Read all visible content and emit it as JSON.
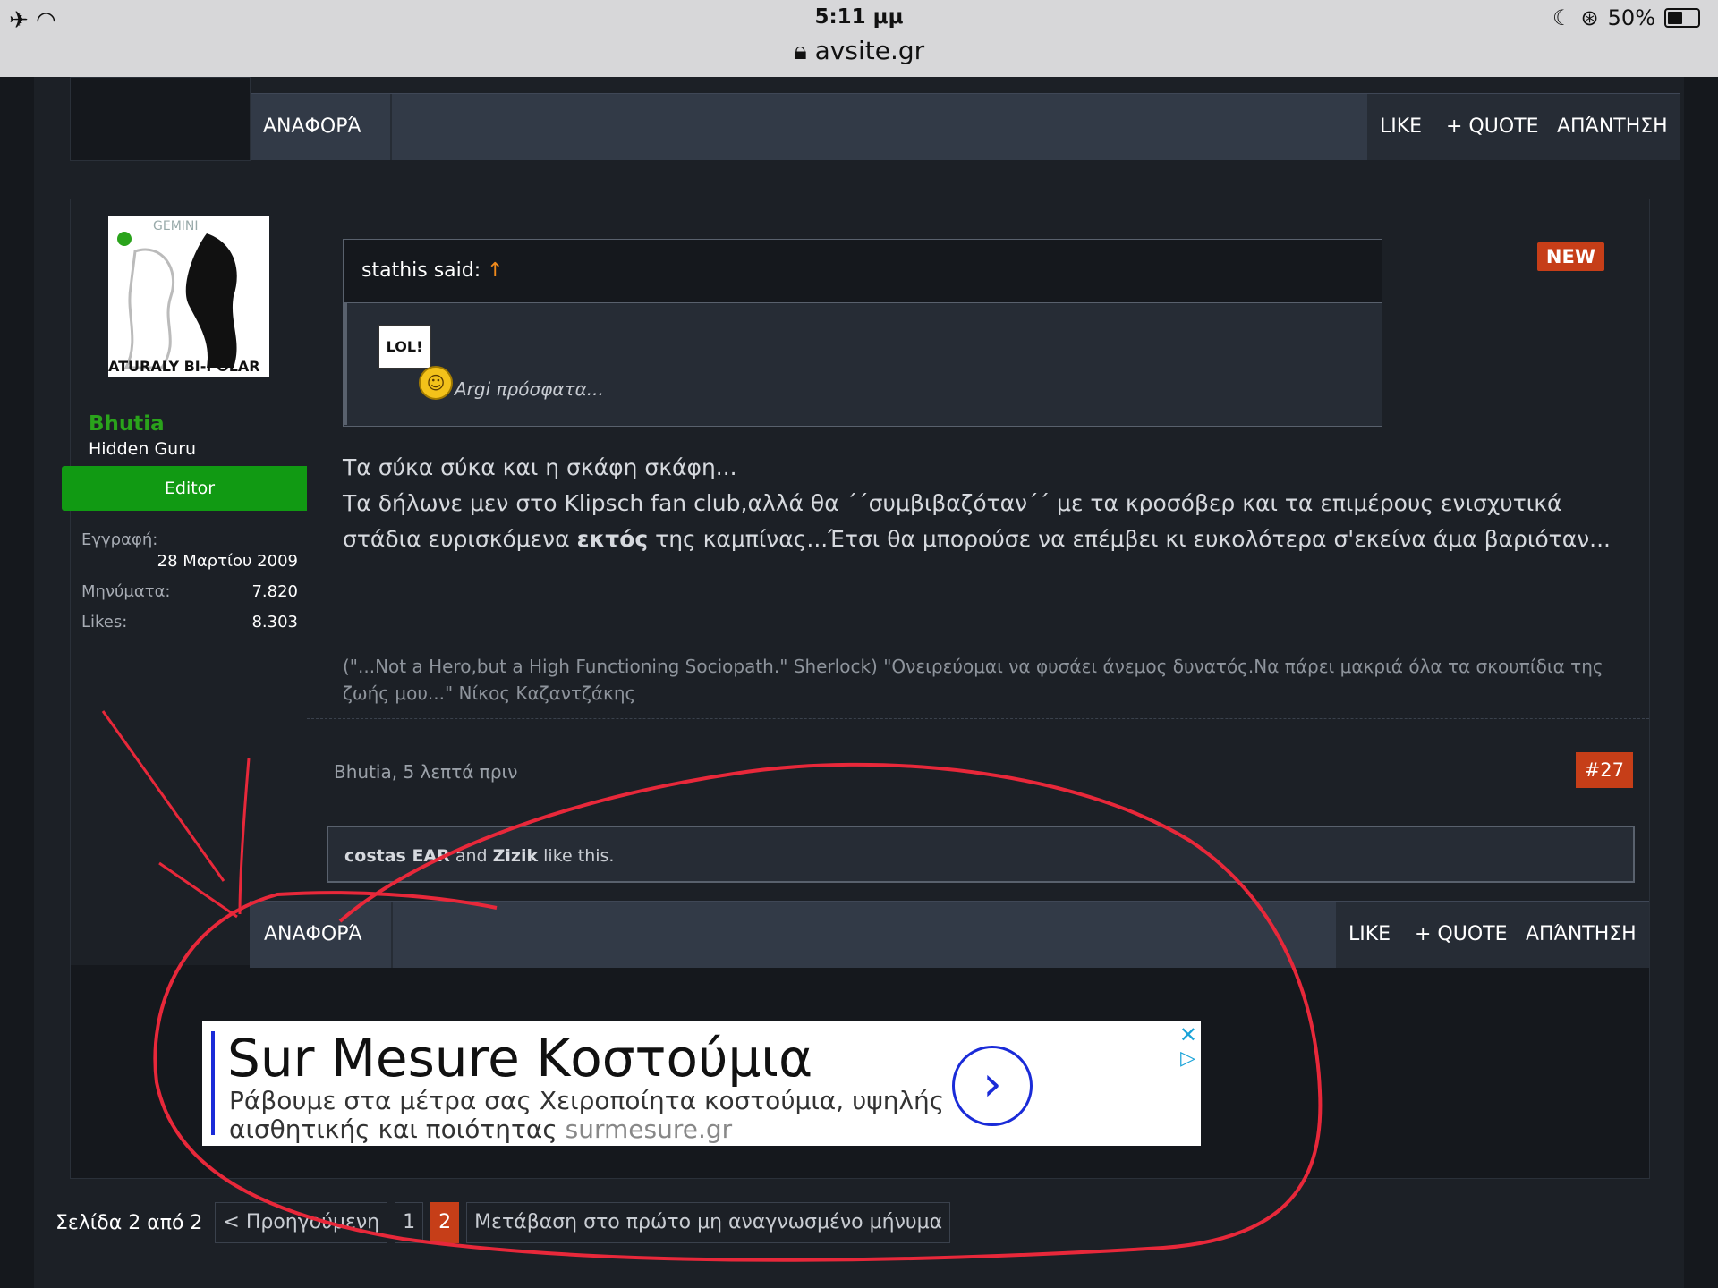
{
  "statusbar": {
    "time": "5:11 μμ",
    "url": "avsite.gr",
    "battery": "50%"
  },
  "post_footer_top": {
    "report": "ΑΝΑΦΟΡΆ",
    "like": "LIKE",
    "quote": "+ QUOTE",
    "reply": "ΑΠΆΝΤΗΣΗ"
  },
  "user": {
    "name": "Bhutia",
    "title": "Hidden Guru",
    "role": "Editor",
    "avatar_text": "ATURALY BI-POLAR",
    "avatar_top_text": "GEMINI",
    "stats": [
      {
        "label": "Εγγραφή:",
        "value": ""
      },
      {
        "label": "",
        "value": "28 Μαρτίου 2009"
      },
      {
        "label": "Μηνύματα:",
        "value": "7.820"
      },
      {
        "label": "Likes:",
        "value": "8.303"
      }
    ]
  },
  "post": {
    "new_badge": "NEW",
    "quote_author": "stathis said:",
    "quote_arrow": "↑",
    "quote_sign": "LOL!",
    "quote_text": "Argi πρόσφατα...",
    "body_line1": "Τα σύκα σύκα και η σκάφη σκάφη...",
    "body_line2a": "Τα δήλωνε μεν στο Klipsch fan club,αλλά θα ΄΄συμβιβαζόταν΄΄ με τα κροσόβερ και τα επιμέρους ενισχυτικά στάδια ευρισκόμενα ",
    "body_bold": "εκτός",
    "body_line2b": " της καμπίνας...Έτσι θα μπορούσε να επέμβει κι ευκολότερα σ'εκείνα άμα βαριόταν...",
    "signature": "(\"...Not a Hero,but a High Functioning Sociopath.\" Sherlock) \"Ονειρεύομαι να φυσάει άνεμος δυνατός.Να πάρει μακριά όλα τα σκουπίδια της ζωής μου...\" Νίκος Καζαντζάκης",
    "meta": "Bhutia, 5 λεπτά πριν",
    "number": "#27",
    "likes_user1": "costas EAR",
    "likes_and": " and ",
    "likes_user2": "Zizik",
    "likes_suffix": " like this."
  },
  "post_footer_bottom": {
    "report": "ΑΝΑΦΟΡΆ",
    "like": "LIKE",
    "quote": "+ QUOTE",
    "reply": "ΑΠΆΝΤΗΣΗ"
  },
  "ad": {
    "title": "Sur Mesure Κοστούμια",
    "description": "Ράβουμε στα μέτρα σας Χειροποίητα κοστούμια, υψηλής αισθητικής και ποιότητας",
    "domain": "surmesure.gr",
    "close": "✕",
    "info": "▷"
  },
  "pager": {
    "label": "Σελίδα 2 από 2",
    "prev": "< Προηγούμενη",
    "page1": "1",
    "page2": "2",
    "first_unread": "Μετάβαση στο πρώτο μη αναγνωσμένο μήνυμα"
  },
  "colors": {
    "accent": "#c63e18",
    "online": "#2aa31b",
    "annotation": "#e8283a"
  }
}
